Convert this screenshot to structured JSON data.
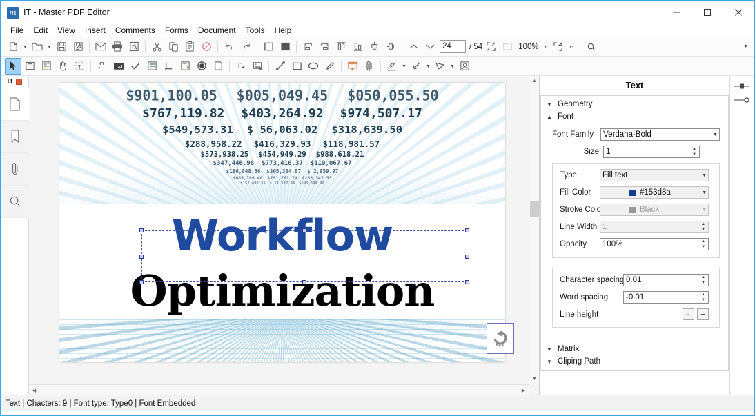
{
  "window": {
    "title": "IT - Master PDF Editor",
    "logo_text": "m",
    "controls": {
      "minimize": "minimize-icon",
      "maximize": "maximize-icon",
      "close": "close-icon"
    }
  },
  "menubar": {
    "items": [
      "File",
      "Edit",
      "View",
      "Insert",
      "Comments",
      "Forms",
      "Document",
      "Tools",
      "Help"
    ]
  },
  "toolbar_main": {
    "buttons": [
      {
        "name": "new-document-button",
        "icon": "new-page-icon"
      },
      {
        "name": "new-document-dropdown",
        "icon": "chevron-down-icon"
      },
      {
        "name": "open-document-button",
        "icon": "folder-icon"
      },
      {
        "name": "open-document-dropdown",
        "icon": "chevron-down-icon"
      },
      {
        "name": "save-button",
        "icon": "floppy-disk-icon"
      },
      {
        "name": "save-as-button",
        "icon": "floppy-disk-pen-icon"
      },
      {
        "name": "email-button",
        "icon": "envelope-icon"
      },
      {
        "name": "print-button",
        "icon": "printer-icon"
      },
      {
        "name": "print-preview-button",
        "icon": "page-magnifier-icon"
      },
      {
        "name": "cut-button",
        "icon": "scissors-icon"
      },
      {
        "name": "copy-button",
        "icon": "copy-pages-icon"
      },
      {
        "name": "paste-button",
        "icon": "clipboard-icon"
      },
      {
        "name": "cancel-button",
        "icon": "no-entry-icon"
      },
      {
        "name": "undo-button",
        "icon": "undo-arrow-icon"
      },
      {
        "name": "redo-button",
        "icon": "redo-arrow-icon"
      },
      {
        "name": "outline-object-button",
        "icon": "square-outline-icon"
      },
      {
        "name": "fill-object-button",
        "icon": "square-filled-icon"
      },
      {
        "name": "align-left-button",
        "icon": "align-left-icon"
      },
      {
        "name": "align-right-button",
        "icon": "align-right-icon"
      },
      {
        "name": "align-top-button",
        "icon": "align-top-icon"
      },
      {
        "name": "align-bottom-button",
        "icon": "align-bottom-icon"
      },
      {
        "name": "center-horizontal-button",
        "icon": "center-horizontal-icon"
      },
      {
        "name": "center-vertical-button",
        "icon": "center-vertical-icon"
      },
      {
        "name": "previous-page-button",
        "icon": "chevron-up-icon"
      },
      {
        "name": "next-page-button",
        "icon": "chevron-down-icon"
      }
    ],
    "page_number": "24",
    "page_total": "/ 54",
    "zoom_out_button": "zoom-out-icon",
    "zoom_level": "100%",
    "zoom_separator": "·",
    "zoom_in_button": "zoom-in-icon",
    "fit_page_button": "fit-page-icon",
    "fit_width_button": "fit-width-icon",
    "more_label": "··",
    "search_button": "search-icon",
    "overflow_button": "chevron-down-icon"
  },
  "toolbar_tools": {
    "buttons": [
      {
        "name": "select-tool",
        "icon": "arrow-cursor-icon",
        "active": true
      },
      {
        "name": "edit-text-tool",
        "icon": "text-column-icon",
        "active": false
      },
      {
        "name": "edit-object-tool",
        "icon": "object-edit-icon",
        "active": false
      },
      {
        "name": "hand-tool",
        "icon": "hand-icon",
        "active": false
      },
      {
        "name": "select-text-tool",
        "icon": "select-text-icon",
        "active": false
      },
      {
        "name": "link-tool",
        "icon": "link-icon",
        "active": false
      },
      {
        "name": "text-field-tool",
        "icon": "text-field-icon",
        "active": false
      },
      {
        "name": "checkbox-tool",
        "icon": "checkmark-icon",
        "active": false
      },
      {
        "name": "list-box-tool",
        "icon": "list-box-icon",
        "active": false
      },
      {
        "name": "text-baseline-tool",
        "icon": "baseline-icon",
        "active": false
      },
      {
        "name": "combo-box-tool",
        "icon": "combo-box-icon",
        "active": false
      },
      {
        "name": "radio-button-tool",
        "icon": "radio-circle-icon",
        "active": false
      },
      {
        "name": "button-tool",
        "icon": "page-corner-icon",
        "active": false
      },
      {
        "name": "add-text-tool",
        "icon": "add-text-icon",
        "active": false
      },
      {
        "name": "add-image-tool",
        "icon": "add-image-icon",
        "active": false
      },
      {
        "name": "line-tool",
        "icon": "line-icon",
        "active": false
      },
      {
        "name": "rectangle-tool",
        "icon": "rectangle-icon",
        "active": false
      },
      {
        "name": "ellipse-tool",
        "icon": "ellipse-icon",
        "active": false
      },
      {
        "name": "pencil-tool",
        "icon": "pencil-icon",
        "active": false
      },
      {
        "name": "sticky-note-tool",
        "icon": "sticky-note-icon",
        "active": false
      },
      {
        "name": "attachment-tool",
        "icon": "paperclip-icon",
        "active": false
      },
      {
        "name": "highlight-tool",
        "icon": "highlighter-icon",
        "active": false
      },
      {
        "name": "highlight-dropdown",
        "icon": "chevron-down-icon",
        "active": false
      },
      {
        "name": "arrow-tool",
        "icon": "arrow-line-icon",
        "active": false
      },
      {
        "name": "arrow-dropdown",
        "icon": "chevron-down-icon",
        "active": false
      },
      {
        "name": "polygon-tool",
        "icon": "polygon-icon",
        "active": false
      },
      {
        "name": "polygon-dropdown",
        "icon": "chevron-down-icon",
        "active": false
      },
      {
        "name": "stamp-tool",
        "icon": "stamp-person-icon",
        "active": false
      }
    ]
  },
  "sidebar": {
    "tab_label": "IT",
    "tab_close_icon": "close-tab-icon",
    "items": [
      {
        "name": "pages-panel-button",
        "icon": "page-icon"
      },
      {
        "name": "bookmarks-panel-button",
        "icon": "bookmark-icon"
      },
      {
        "name": "attachments-panel-button",
        "icon": "paperclip-icon"
      },
      {
        "name": "search-panel-button",
        "icon": "search-icon"
      }
    ]
  },
  "document": {
    "headline_1": "Workflow",
    "headline_1_color": "#1e4ba0",
    "headline_2": "Optimization",
    "headline_2_color": "#000000",
    "background_numbers": [
      [
        "$901,100.05",
        "$005,049.45",
        "$050,055.50"
      ],
      [
        "$767,119.82",
        "$403,264.92",
        "$974,507.17"
      ],
      [
        "$549,573.31",
        "$ 56,063.02",
        "$318,639.50"
      ],
      [
        "$288,958.22",
        "$416,329.93",
        "$118,981.57"
      ],
      [
        "$573,938.25",
        "$454,949.29",
        "$988,618.21"
      ],
      [
        "$347,446.98",
        "$773,416.37",
        "$119,067.67"
      ],
      [
        "$186,848.66",
        "$305,384.87",
        "$  2,859.97"
      ],
      [
        "$685,786.46",
        "$781,761.74",
        "$285,347.53"
      ],
      [
        "$ 57,692.35",
        "$ 57,327.44",
        "$595,398.90"
      ]
    ],
    "revert_button": "revert-undo-icon",
    "selection_handles": "resize-handle"
  },
  "properties_panel": {
    "title": "Text",
    "sections": [
      {
        "label": "Geometry",
        "expanded": false
      },
      {
        "label": "Font",
        "expanded": true
      },
      {
        "label": "Matrix",
        "expanded": false
      },
      {
        "label": "Cliping Path",
        "expanded": false
      }
    ],
    "font": {
      "family_label": "Font Family",
      "family_value": "Verdana-Bold",
      "size_label": "Size",
      "size_value": "1"
    },
    "fill": {
      "type_label": "Type",
      "type_value": "Fill text",
      "fill_color_label": "Fill Color",
      "fill_color_value": "#153d8a",
      "fill_color_swatch": "#153d8a",
      "stroke_color_label": "Stroke Color",
      "stroke_color_value": "Black",
      "stroke_color_swatch": "#7a7a7a",
      "line_width_label": "Line Width",
      "line_width_value": "1",
      "opacity_label": "Opacity",
      "opacity_value": "100%"
    },
    "spacing": {
      "character_spacing_label": "Character spacing",
      "character_spacing_value": "0.01",
      "word_spacing_label": "Word spacing",
      "word_spacing_value": "-0.01",
      "line_height_label": "Line height",
      "line_height_minus": "-",
      "line_height_plus": "+"
    },
    "edge_icons": [
      {
        "name": "properties-slider-icon"
      },
      {
        "name": "settings-slider-icon"
      }
    ]
  },
  "statusbar": {
    "text": "Text | Chacters: 9 | Font type: Type0 | Font Embedded"
  }
}
